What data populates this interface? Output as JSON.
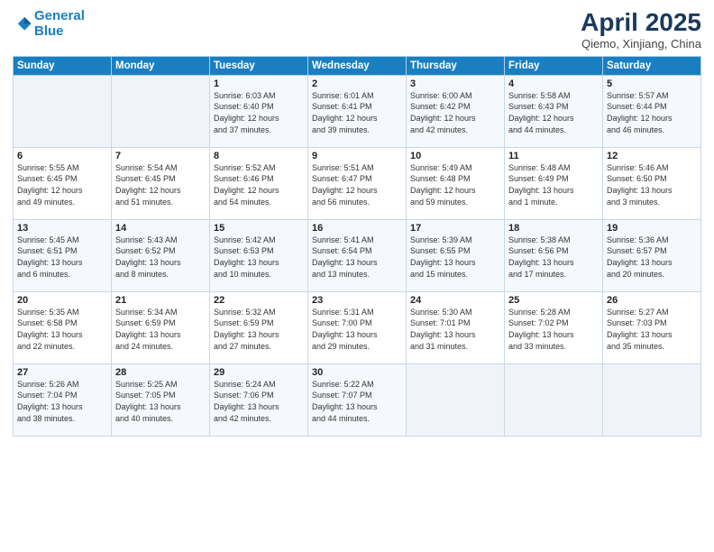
{
  "header": {
    "logo_line1": "General",
    "logo_line2": "Blue",
    "month": "April 2025",
    "location": "Qiemo, Xinjiang, China"
  },
  "weekdays": [
    "Sunday",
    "Monday",
    "Tuesday",
    "Wednesday",
    "Thursday",
    "Friday",
    "Saturday"
  ],
  "weeks": [
    [
      {
        "day": "",
        "info": ""
      },
      {
        "day": "",
        "info": ""
      },
      {
        "day": "1",
        "info": "Sunrise: 6:03 AM\nSunset: 6:40 PM\nDaylight: 12 hours\nand 37 minutes."
      },
      {
        "day": "2",
        "info": "Sunrise: 6:01 AM\nSunset: 6:41 PM\nDaylight: 12 hours\nand 39 minutes."
      },
      {
        "day": "3",
        "info": "Sunrise: 6:00 AM\nSunset: 6:42 PM\nDaylight: 12 hours\nand 42 minutes."
      },
      {
        "day": "4",
        "info": "Sunrise: 5:58 AM\nSunset: 6:43 PM\nDaylight: 12 hours\nand 44 minutes."
      },
      {
        "day": "5",
        "info": "Sunrise: 5:57 AM\nSunset: 6:44 PM\nDaylight: 12 hours\nand 46 minutes."
      }
    ],
    [
      {
        "day": "6",
        "info": "Sunrise: 5:55 AM\nSunset: 6:45 PM\nDaylight: 12 hours\nand 49 minutes."
      },
      {
        "day": "7",
        "info": "Sunrise: 5:54 AM\nSunset: 6:45 PM\nDaylight: 12 hours\nand 51 minutes."
      },
      {
        "day": "8",
        "info": "Sunrise: 5:52 AM\nSunset: 6:46 PM\nDaylight: 12 hours\nand 54 minutes."
      },
      {
        "day": "9",
        "info": "Sunrise: 5:51 AM\nSunset: 6:47 PM\nDaylight: 12 hours\nand 56 minutes."
      },
      {
        "day": "10",
        "info": "Sunrise: 5:49 AM\nSunset: 6:48 PM\nDaylight: 12 hours\nand 59 minutes."
      },
      {
        "day": "11",
        "info": "Sunrise: 5:48 AM\nSunset: 6:49 PM\nDaylight: 13 hours\nand 1 minute."
      },
      {
        "day": "12",
        "info": "Sunrise: 5:46 AM\nSunset: 6:50 PM\nDaylight: 13 hours\nand 3 minutes."
      }
    ],
    [
      {
        "day": "13",
        "info": "Sunrise: 5:45 AM\nSunset: 6:51 PM\nDaylight: 13 hours\nand 6 minutes."
      },
      {
        "day": "14",
        "info": "Sunrise: 5:43 AM\nSunset: 6:52 PM\nDaylight: 13 hours\nand 8 minutes."
      },
      {
        "day": "15",
        "info": "Sunrise: 5:42 AM\nSunset: 6:53 PM\nDaylight: 13 hours\nand 10 minutes."
      },
      {
        "day": "16",
        "info": "Sunrise: 5:41 AM\nSunset: 6:54 PM\nDaylight: 13 hours\nand 13 minutes."
      },
      {
        "day": "17",
        "info": "Sunrise: 5:39 AM\nSunset: 6:55 PM\nDaylight: 13 hours\nand 15 minutes."
      },
      {
        "day": "18",
        "info": "Sunrise: 5:38 AM\nSunset: 6:56 PM\nDaylight: 13 hours\nand 17 minutes."
      },
      {
        "day": "19",
        "info": "Sunrise: 5:36 AM\nSunset: 6:57 PM\nDaylight: 13 hours\nand 20 minutes."
      }
    ],
    [
      {
        "day": "20",
        "info": "Sunrise: 5:35 AM\nSunset: 6:58 PM\nDaylight: 13 hours\nand 22 minutes."
      },
      {
        "day": "21",
        "info": "Sunrise: 5:34 AM\nSunset: 6:59 PM\nDaylight: 13 hours\nand 24 minutes."
      },
      {
        "day": "22",
        "info": "Sunrise: 5:32 AM\nSunset: 6:59 PM\nDaylight: 13 hours\nand 27 minutes."
      },
      {
        "day": "23",
        "info": "Sunrise: 5:31 AM\nSunset: 7:00 PM\nDaylight: 13 hours\nand 29 minutes."
      },
      {
        "day": "24",
        "info": "Sunrise: 5:30 AM\nSunset: 7:01 PM\nDaylight: 13 hours\nand 31 minutes."
      },
      {
        "day": "25",
        "info": "Sunrise: 5:28 AM\nSunset: 7:02 PM\nDaylight: 13 hours\nand 33 minutes."
      },
      {
        "day": "26",
        "info": "Sunrise: 5:27 AM\nSunset: 7:03 PM\nDaylight: 13 hours\nand 35 minutes."
      }
    ],
    [
      {
        "day": "27",
        "info": "Sunrise: 5:26 AM\nSunset: 7:04 PM\nDaylight: 13 hours\nand 38 minutes."
      },
      {
        "day": "28",
        "info": "Sunrise: 5:25 AM\nSunset: 7:05 PM\nDaylight: 13 hours\nand 40 minutes."
      },
      {
        "day": "29",
        "info": "Sunrise: 5:24 AM\nSunset: 7:06 PM\nDaylight: 13 hours\nand 42 minutes."
      },
      {
        "day": "30",
        "info": "Sunrise: 5:22 AM\nSunset: 7:07 PM\nDaylight: 13 hours\nand 44 minutes."
      },
      {
        "day": "",
        "info": ""
      },
      {
        "day": "",
        "info": ""
      },
      {
        "day": "",
        "info": ""
      }
    ]
  ]
}
